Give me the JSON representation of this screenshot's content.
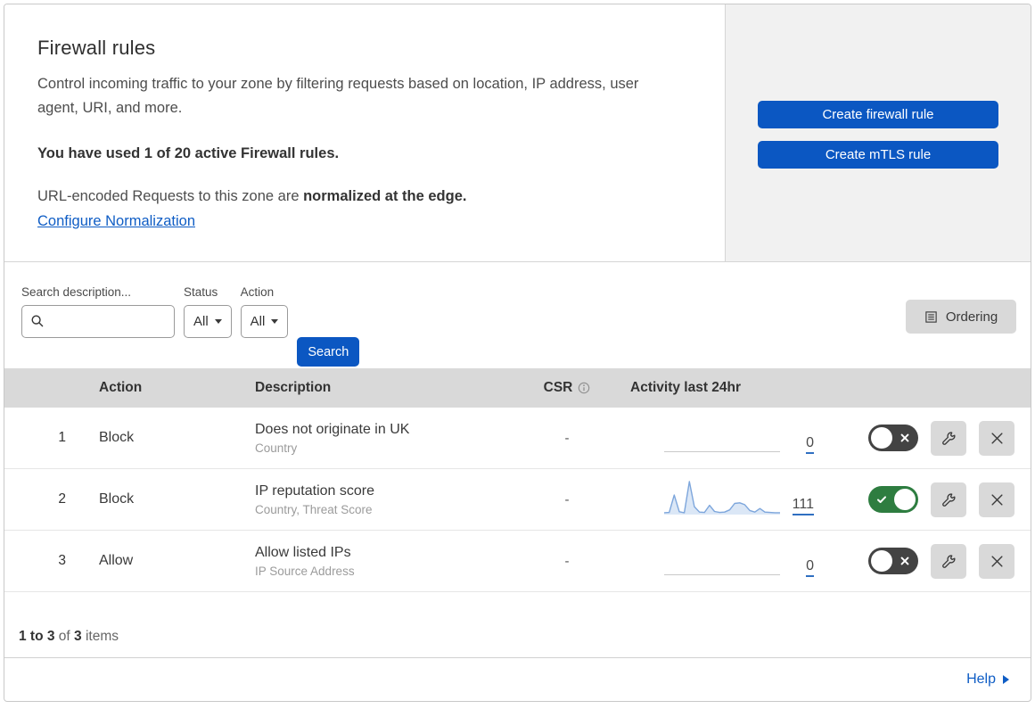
{
  "header": {
    "title": "Firewall rules",
    "description": "Control incoming traffic to your zone by filtering requests based on location, IP address, user agent, URI, and more.",
    "usage_note": "You have used 1 of 20 active Firewall rules.",
    "normalization_prefix": "URL-encoded Requests to this zone are ",
    "normalization_bold": "normalized at the edge.",
    "normalization_link": "Configure Normalization",
    "create_firewall_button": "Create firewall rule",
    "create_mtls_button": "Create mTLS rule"
  },
  "filters": {
    "search_label": "Search description...",
    "search_value": "",
    "status_label": "Status",
    "status_value": "All",
    "action_label": "Action",
    "action_value": "All",
    "search_button": "Search",
    "ordering_button": "Ordering"
  },
  "table": {
    "headers": {
      "action": "Action",
      "description": "Description",
      "csr": "CSR",
      "activity": "Activity last 24hr"
    },
    "rows": [
      {
        "priority": "1",
        "action": "Block",
        "description": "Does not originate in UK",
        "fields": "Country",
        "csr": "-",
        "activity_count": "0",
        "enabled": false
      },
      {
        "priority": "2",
        "action": "Block",
        "description": "IP reputation score",
        "fields": "Country, Threat Score",
        "csr": "-",
        "activity_count": "111",
        "enabled": true
      },
      {
        "priority": "3",
        "action": "Allow",
        "description": "Allow listed IPs",
        "fields": "IP Source Address",
        "csr": "-",
        "activity_count": "0",
        "enabled": false
      }
    ]
  },
  "footer": {
    "range": "1 to 3",
    "of_word": "of",
    "total": "3",
    "items_word": "items",
    "help_label": "Help"
  },
  "chart_data": {
    "type": "line",
    "title": "Activity last 24hr sparkline — rule 2 (IP reputation score)",
    "x": [
      0,
      1,
      2,
      3,
      4,
      5,
      6,
      7,
      8,
      9,
      10,
      11,
      12,
      13,
      14,
      15,
      16,
      17,
      18,
      19,
      20,
      21,
      22,
      23
    ],
    "values": [
      3,
      4,
      58,
      6,
      3,
      100,
      22,
      5,
      4,
      26,
      7,
      4,
      5,
      12,
      32,
      34,
      28,
      10,
      5,
      16,
      5,
      4,
      3,
      3
    ],
    "ylim": [
      0,
      100
    ],
    "total_events": 111,
    "grid": false,
    "legend": false
  },
  "colors": {
    "primary_blue": "#0b57c2",
    "link_blue": "#0f5dc5",
    "toggle_on_green": "#2e7d40",
    "toggle_off_gray": "#434343",
    "table_header_bg": "#d9d9d9",
    "side_panel_bg": "#f1f1f1",
    "gray_button_bg": "#d9d9d9",
    "sparkline_line": "#7da6dc",
    "sparkline_fill": "#dbe7f6",
    "border_gray": "#c9c9c9"
  }
}
